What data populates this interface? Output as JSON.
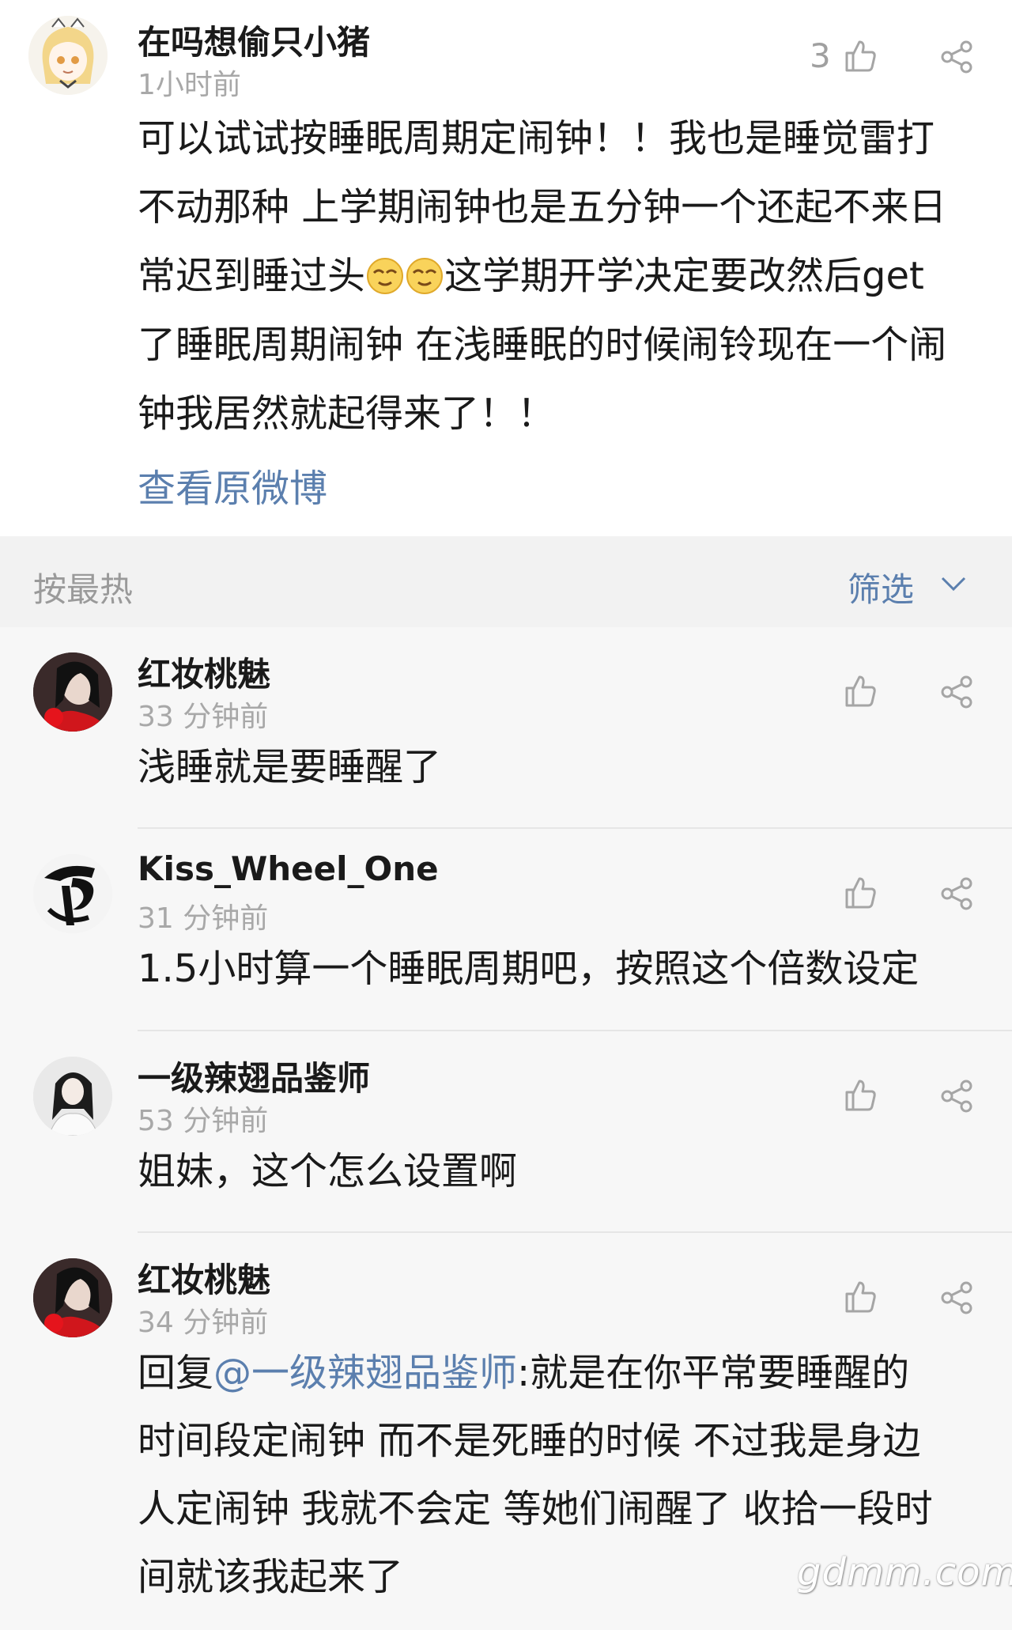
{
  "post": {
    "username": "在吗想偷只小猪",
    "time": "1小时前",
    "like_count": "3",
    "lines": [
      "可以试试按睡眠周期定闹钟！！我也是睡觉雷打",
      "不动那种 上学期闹钟也是五分钟一个还起不来日",
      "常迟到睡过头",
      "这学期开学决定要改然后get",
      "了睡眠周期闹钟 在浅睡眠的时候闹铃现在一个闹",
      "钟我居然就起得来了！！"
    ],
    "emoji_name": "smirk-emoji",
    "view_original": "查看原微博"
  },
  "sort": {
    "label": "按最热",
    "filter": "筛选"
  },
  "comments": [
    {
      "username": "红妆桃魅",
      "time": "33 分钟前",
      "lines": [
        "浅睡就是要睡醒了"
      ]
    },
    {
      "username": "Kiss_Wheel_One",
      "time": "31 分钟前",
      "lines": [
        "1.5小时算一个睡眠周期吧，按照这个倍数设定"
      ]
    },
    {
      "username": "一级辣翅品鉴师",
      "time": "53 分钟前",
      "lines": [
        "姐妹，这个怎么设置啊"
      ]
    },
    {
      "username": "红妆桃魅",
      "time": "34 分钟前",
      "reply_prefix": "回复",
      "mention": "@一级辣翅品鉴师",
      "lines": [
        ":就是在你平常要睡醒的",
        "时间段定闹钟 而不是死睡的时候 不过我是身边",
        "人定闹钟 我就不会定 等她们闹醒了 收拾一段时",
        "间就该我起来了"
      ]
    }
  ],
  "watermark": "gdmm.com",
  "colors": {
    "link": "#5b7fae",
    "secondary_text": "#a8a8a8",
    "comment_bg": "#f7f7f7",
    "post_bg": "#ffffff"
  }
}
